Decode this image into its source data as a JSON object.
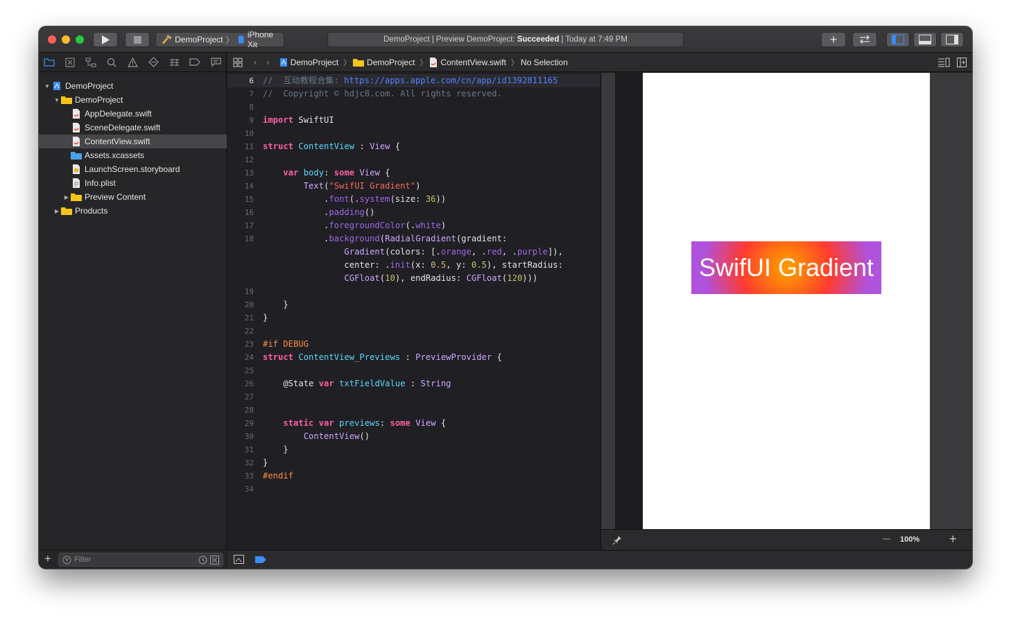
{
  "toolbar": {
    "run_icon": "play-icon",
    "stop_icon": "stop-icon",
    "scheme_name": "DemoProject",
    "destination": "iPhone Xʀ",
    "status_prefix": "DemoProject | Preview DemoProject:",
    "status_result": "Succeeded",
    "status_suffix": "| Today at 7:49 PM",
    "library_label": "+",
    "colors": {
      "close": "#fe5f57",
      "minimize": "#febc2e",
      "zoom": "#28c840",
      "accent": "#3b8cf5"
    }
  },
  "navigator": {
    "tree": [
      {
        "label": "DemoProject",
        "indent": 0,
        "type": "project",
        "expanded": true
      },
      {
        "label": "DemoProject",
        "indent": 1,
        "type": "folder",
        "expanded": true
      },
      {
        "label": "AppDelegate.swift",
        "indent": 2,
        "type": "swift"
      },
      {
        "label": "SceneDelegate.swift",
        "indent": 2,
        "type": "swift"
      },
      {
        "label": "ContentView.swift",
        "indent": 2,
        "type": "swift",
        "selected": true
      },
      {
        "label": "Assets.xcassets",
        "indent": 2,
        "type": "assets"
      },
      {
        "label": "LaunchScreen.storyboard",
        "indent": 2,
        "type": "storyboard"
      },
      {
        "label": "Info.plist",
        "indent": 2,
        "type": "plist"
      },
      {
        "label": "Preview Content",
        "indent": 2,
        "type": "folder",
        "expanded": false
      },
      {
        "label": "Products",
        "indent": 1,
        "type": "folder",
        "expanded": false
      }
    ],
    "filter_placeholder": "Filter",
    "add_label": "+"
  },
  "jumpbar": {
    "crumbs": [
      "DemoProject",
      "DemoProject",
      "ContentView.swift",
      "No Selection"
    ]
  },
  "editor": {
    "lines": [
      {
        "n": "6",
        "tokens": [
          [
            "cmt",
            "//  "
          ],
          [
            "cmt",
            "互动教程合集: "
          ],
          [
            "link",
            "https://apps.apple.com/cn/app/id1392811165"
          ]
        ],
        "current": true
      },
      {
        "n": "7",
        "tokens": [
          [
            "cmt",
            "//  Copyright © hdjc8.com. All rights reserved."
          ]
        ]
      },
      {
        "n": "8",
        "tokens": []
      },
      {
        "n": "9",
        "tokens": [
          [
            "kw",
            "import"
          ],
          [
            "",
            " SwiftUI"
          ]
        ]
      },
      {
        "n": "10",
        "tokens": []
      },
      {
        "n": "11",
        "tokens": [
          [
            "kw",
            "struct"
          ],
          [
            "",
            " "
          ],
          [
            "ty2",
            "ContentView"
          ],
          [
            "",
            " : "
          ],
          [
            "ty",
            "View"
          ],
          [
            "",
            " {"
          ]
        ]
      },
      {
        "n": "12",
        "tokens": []
      },
      {
        "n": "13",
        "tokens": [
          [
            "",
            "    "
          ],
          [
            "kw",
            "var"
          ],
          [
            "",
            " "
          ],
          [
            "ty2",
            "body"
          ],
          [
            "",
            ": "
          ],
          [
            "kw",
            "some"
          ],
          [
            "",
            " "
          ],
          [
            "ty",
            "View"
          ],
          [
            "",
            " {"
          ]
        ]
      },
      {
        "n": "14",
        "tokens": [
          [
            "",
            "        "
          ],
          [
            "ty",
            "Text"
          ],
          [
            "",
            "("
          ],
          [
            "str",
            "\"SwifUI Gradient\""
          ],
          [
            "",
            ")"
          ]
        ]
      },
      {
        "n": "15",
        "tokens": [
          [
            "",
            "            ."
          ],
          [
            "dot",
            "font"
          ],
          [
            "",
            "(."
          ],
          [
            "dot",
            "system"
          ],
          [
            "",
            "(size: "
          ],
          [
            "num-lit",
            "36"
          ],
          [
            "",
            "))"
          ]
        ]
      },
      {
        "n": "16",
        "tokens": [
          [
            "",
            "            ."
          ],
          [
            "dot",
            "padding"
          ],
          [
            "",
            "()"
          ]
        ]
      },
      {
        "n": "17",
        "tokens": [
          [
            "",
            "            ."
          ],
          [
            "dot",
            "foregroundColor"
          ],
          [
            "",
            "(."
          ],
          [
            "dot",
            "white"
          ],
          [
            "",
            ")"
          ]
        ]
      },
      {
        "n": "18",
        "tokens": [
          [
            "",
            "            ."
          ],
          [
            "dot",
            "background"
          ],
          [
            "",
            "("
          ],
          [
            "ty",
            "RadialGradient"
          ],
          [
            "",
            "(gradient:"
          ]
        ]
      },
      {
        "n": "",
        "tokens": [
          [
            "",
            "                "
          ],
          [
            "ty",
            "Gradient"
          ],
          [
            "",
            "(colors: [."
          ],
          [
            "dot",
            "orange"
          ],
          [
            "",
            ", ."
          ],
          [
            "dot",
            "red"
          ],
          [
            "",
            ", ."
          ],
          [
            "dot",
            "purple"
          ],
          [
            "",
            "]),"
          ]
        ]
      },
      {
        "n": "",
        "tokens": [
          [
            "",
            "                center: ."
          ],
          [
            "dot",
            "init"
          ],
          [
            "",
            "(x: "
          ],
          [
            "num-lit",
            "0.5"
          ],
          [
            "",
            ", y: "
          ],
          [
            "num-lit",
            "0.5"
          ],
          [
            "",
            "), startRadius:"
          ]
        ]
      },
      {
        "n": "",
        "tokens": [
          [
            "",
            "                "
          ],
          [
            "ty",
            "CGFloat"
          ],
          [
            "",
            "("
          ],
          [
            "num-lit",
            "10"
          ],
          [
            "",
            "), endRadius: "
          ],
          [
            "ty",
            "CGFloat"
          ],
          [
            "",
            "("
          ],
          [
            "num-lit",
            "120"
          ],
          [
            "",
            ")))"
          ]
        ]
      },
      {
        "n": "19",
        "tokens": []
      },
      {
        "n": "20",
        "tokens": [
          [
            "",
            "    }"
          ]
        ]
      },
      {
        "n": "21",
        "tokens": [
          [
            "",
            "}"
          ]
        ]
      },
      {
        "n": "22",
        "tokens": []
      },
      {
        "n": "23",
        "tokens": [
          [
            "pp",
            "#if DEBUG"
          ]
        ]
      },
      {
        "n": "24",
        "tokens": [
          [
            "kw",
            "struct"
          ],
          [
            "",
            " "
          ],
          [
            "ty2",
            "ContentView_Previews"
          ],
          [
            "",
            " : "
          ],
          [
            "ty",
            "PreviewProvider"
          ],
          [
            "",
            " {"
          ]
        ]
      },
      {
        "n": "25",
        "tokens": []
      },
      {
        "n": "26",
        "tokens": [
          [
            "",
            "    @State "
          ],
          [
            "kw",
            "var"
          ],
          [
            "",
            " "
          ],
          [
            "ty2",
            "txtFieldValue"
          ],
          [
            "",
            " : "
          ],
          [
            "ty",
            "String"
          ]
        ]
      },
      {
        "n": "27",
        "tokens": []
      },
      {
        "n": "28",
        "tokens": []
      },
      {
        "n": "29",
        "tokens": [
          [
            "",
            "    "
          ],
          [
            "kw",
            "static"
          ],
          [
            "",
            " "
          ],
          [
            "kw",
            "var"
          ],
          [
            "",
            " "
          ],
          [
            "ty2",
            "previews"
          ],
          [
            "",
            ": "
          ],
          [
            "kw",
            "some"
          ],
          [
            "",
            " "
          ],
          [
            "ty",
            "View"
          ],
          [
            "",
            " {"
          ]
        ]
      },
      {
        "n": "30",
        "tokens": [
          [
            "",
            "        "
          ],
          [
            "ty",
            "ContentView"
          ],
          [
            "",
            "()"
          ]
        ]
      },
      {
        "n": "31",
        "tokens": [
          [
            "",
            "    }"
          ]
        ]
      },
      {
        "n": "32",
        "tokens": [
          [
            "",
            "}"
          ]
        ]
      },
      {
        "n": "33",
        "tokens": [
          [
            "pp",
            "#endif"
          ]
        ]
      },
      {
        "n": "34",
        "tokens": []
      }
    ]
  },
  "canvas": {
    "preview_text": "SwifUI Gradient",
    "zoom_label": "100%",
    "zoom_out_label": "—",
    "zoom_in_label": "+"
  }
}
